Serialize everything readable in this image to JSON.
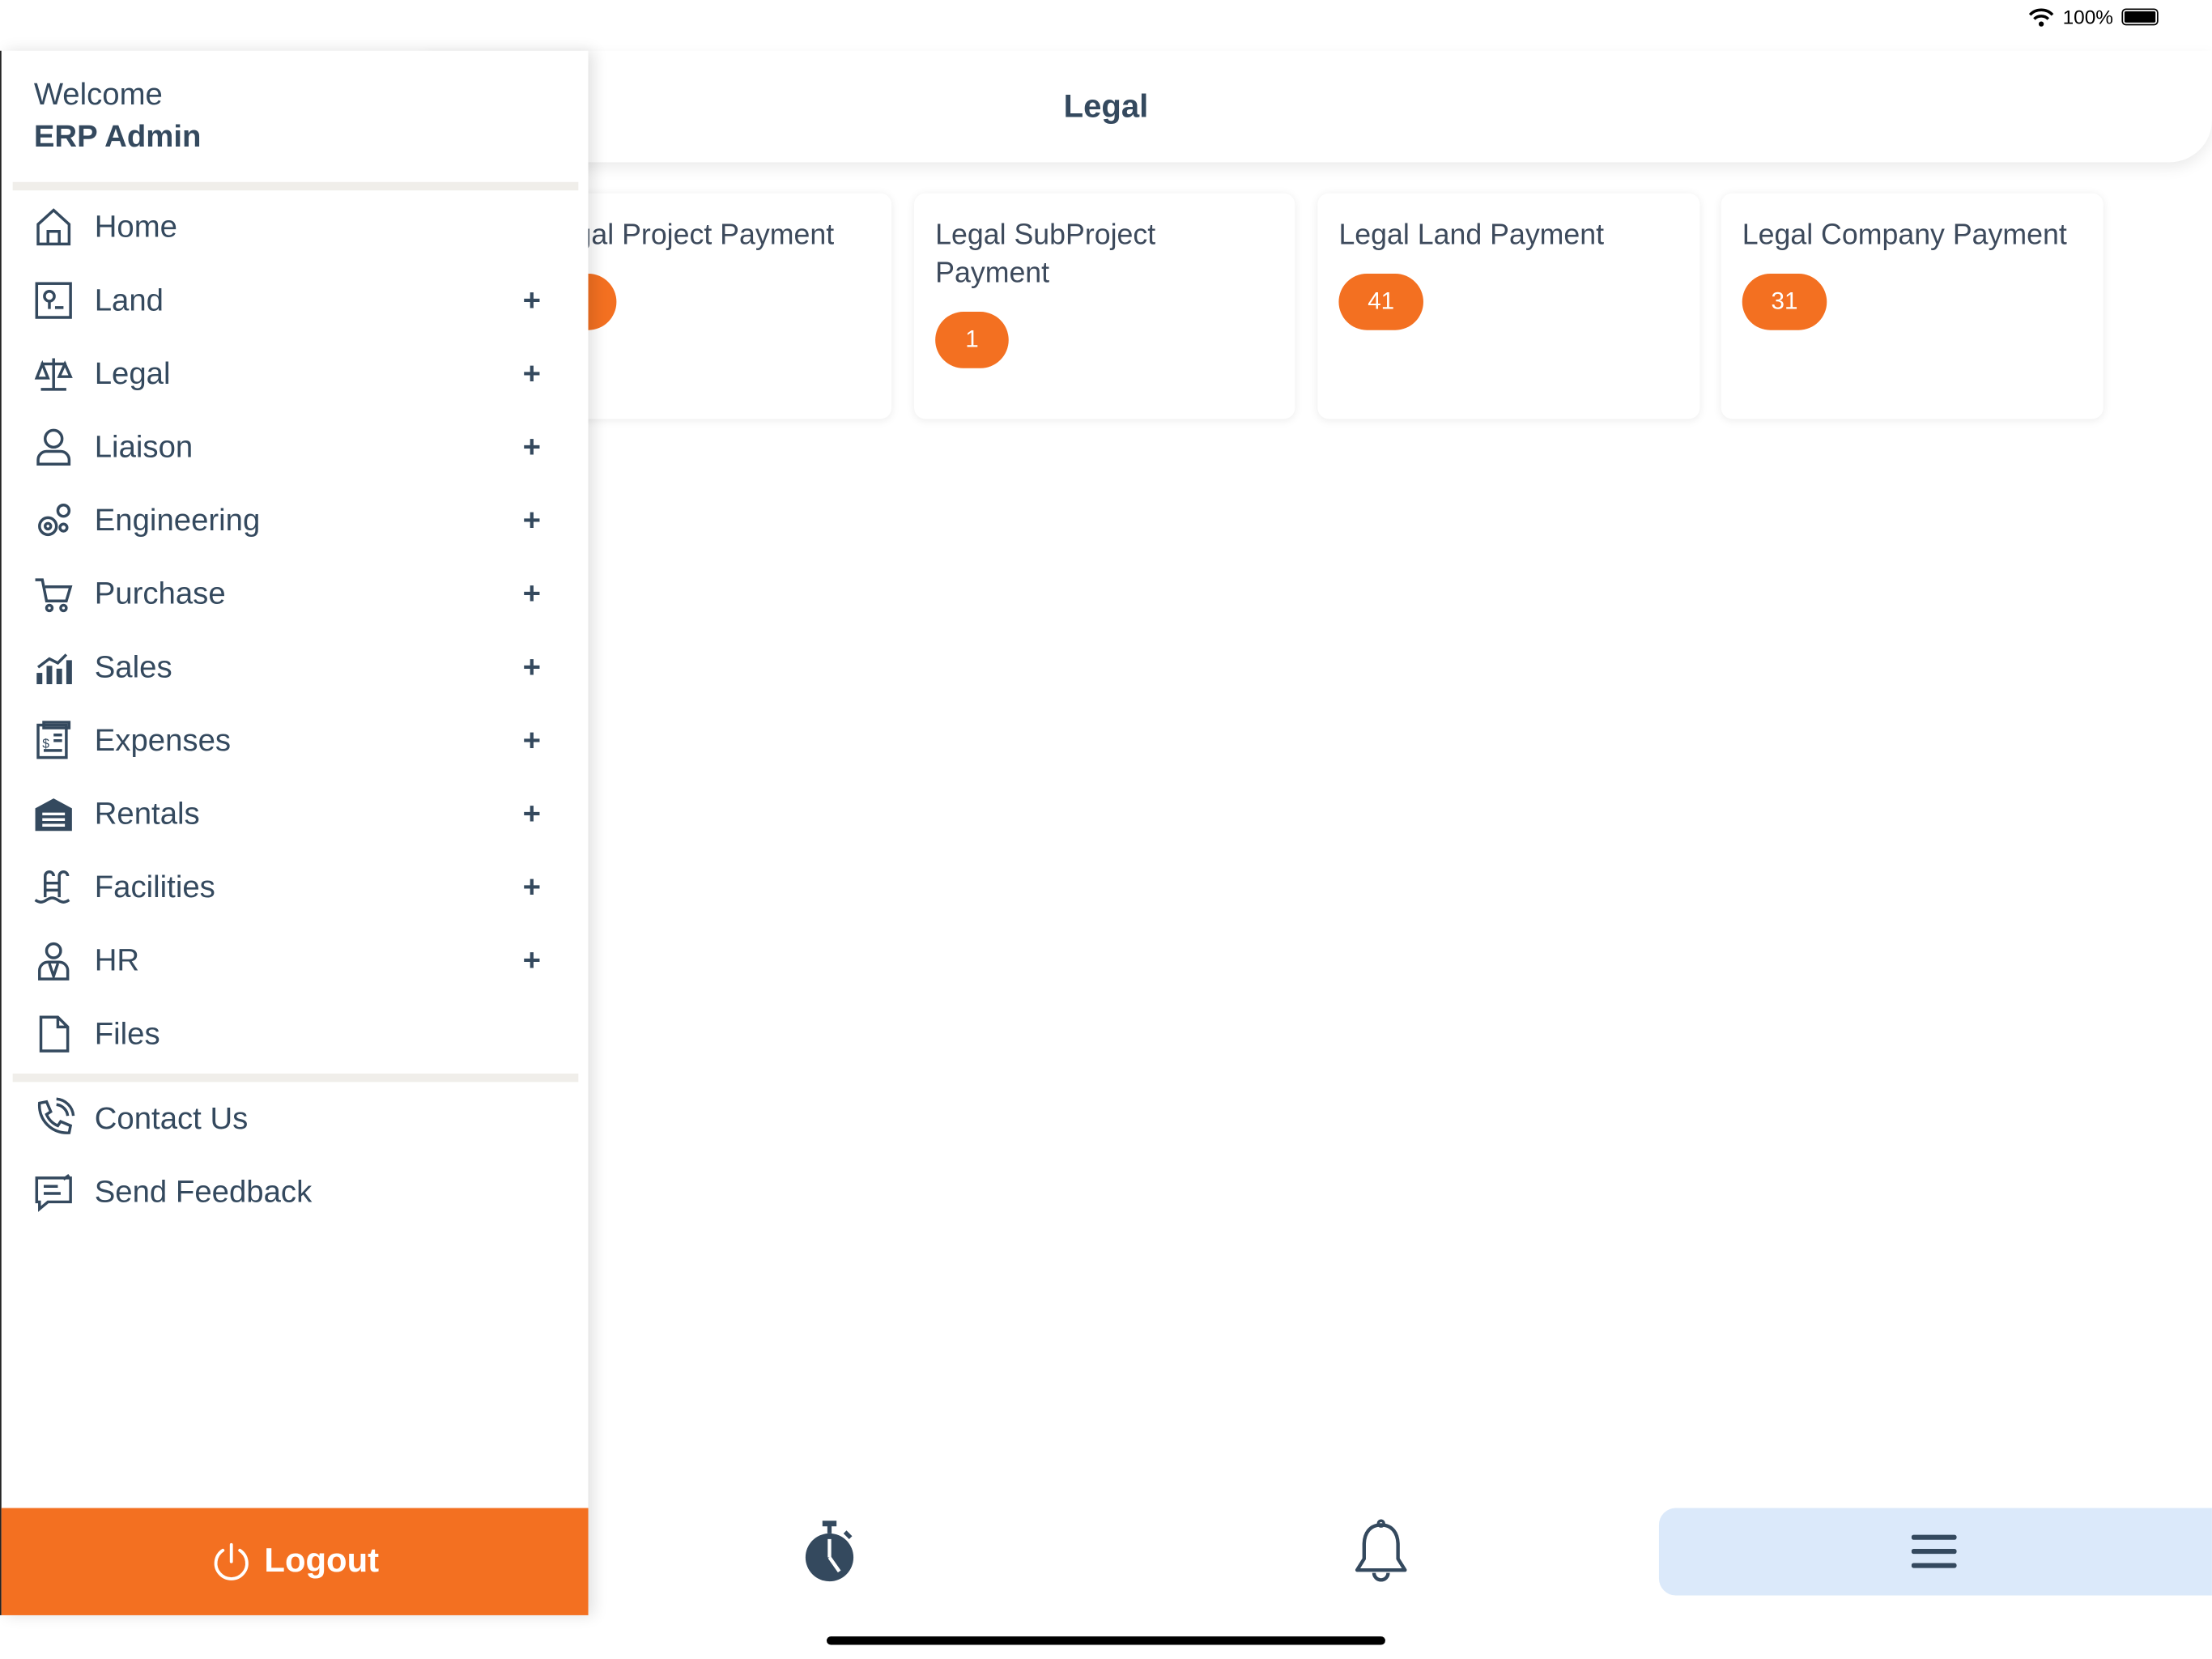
{
  "status_bar": {
    "battery": "100%",
    "battery_level": 1.0,
    "icons": [
      "wifi-icon",
      "battery-icon"
    ]
  },
  "header": {
    "title": "Legal"
  },
  "cards": [
    {
      "title": "Legal Project Payment"
    },
    {
      "title": "Legal SubProject Payment",
      "count": "1"
    },
    {
      "title": "Legal Land Payment",
      "count": "41"
    },
    {
      "title": "Legal Company Payment",
      "count": "31"
    }
  ],
  "colors": {
    "accent": "#f37021",
    "text": "#34495e",
    "active_tab_bg": "#dbe9fa"
  },
  "drawer": {
    "welcome": "Welcome",
    "user": "ERP Admin",
    "items": [
      {
        "label": "Home",
        "icon": "home-icon",
        "expandable": false
      },
      {
        "label": "Land",
        "icon": "land-map-icon",
        "expandable": true
      },
      {
        "label": "Legal",
        "icon": "scales-icon",
        "expandable": true
      },
      {
        "label": "Liaison",
        "icon": "person-icon",
        "expandable": true
      },
      {
        "label": "Engineering",
        "icon": "gears-icon",
        "expandable": true
      },
      {
        "label": "Purchase",
        "icon": "cart-icon",
        "expandable": true
      },
      {
        "label": "Sales",
        "icon": "bar-chart-icon",
        "expandable": true
      },
      {
        "label": "Expenses",
        "icon": "receipt-icon",
        "expandable": true
      },
      {
        "label": "Rentals",
        "icon": "garage-icon",
        "expandable": true
      },
      {
        "label": "Facilities",
        "icon": "pool-icon",
        "expandable": true
      },
      {
        "label": "HR",
        "icon": "employee-icon",
        "expandable": true
      },
      {
        "label": "Files",
        "icon": "file-icon",
        "expandable": false
      }
    ],
    "expand_symbol": "+",
    "extra_items": [
      {
        "label": "Contact Us",
        "icon": "phone-icon"
      },
      {
        "label": "Send Feedback",
        "icon": "feedback-icon"
      }
    ],
    "logout": "Logout"
  },
  "tabbar": {
    "tabs": [
      {
        "icon": "stopwatch-icon"
      },
      {
        "icon": "bell-icon"
      },
      {
        "icon": "menu-icon",
        "active": true
      }
    ]
  }
}
